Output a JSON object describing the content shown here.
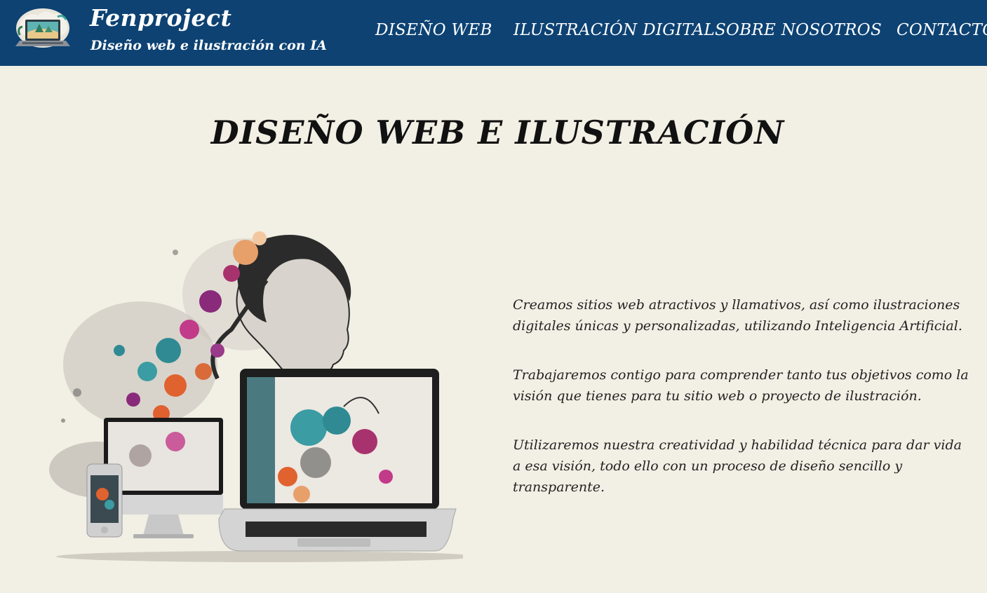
{
  "header": {
    "brand_title": "Fenproject",
    "brand_subtitle": "Diseño web e ilustración con IA",
    "logo_icon": "laptop-island-logo",
    "background_color": "#0d4273",
    "nav": [
      {
        "label": "DISEÑO WEB"
      },
      {
        "label": "ILUSTRACIÓN DIGITAL"
      },
      {
        "label": "SOBRE NOSOTROS"
      },
      {
        "label": "CONTACTO"
      }
    ]
  },
  "main": {
    "title": "DISEÑO WEB E ILUSTRACIÓN",
    "paragraphs": [
      "Creamos sitios web atractivos y llamativos, así como ilustraciones digitales únicas y personalizadas, utilizando Inteligencia Artificial.",
      "Trabajaremos contigo para comprender tanto tus objetivos como la visión que tienes para tu sitio web o proyecto de ilustración.",
      "Utilizaremos nuestra creatividad y habilidad técnica para dar vida a esa visión, todo ello con un proceso de diseño sencillo y transparente."
    ],
    "background_color": "#f2efe4"
  }
}
